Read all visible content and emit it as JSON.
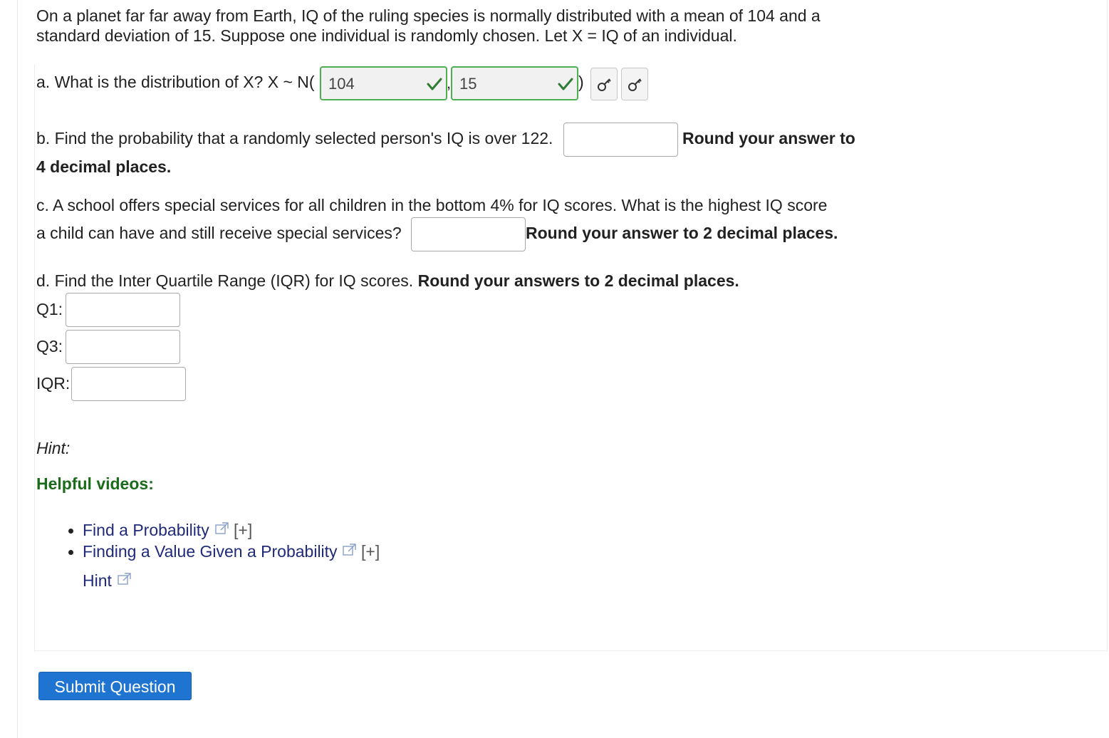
{
  "intro": {
    "line1": "On a planet far far away from Earth, IQ of the ruling species is normally distributed with a mean of 104 and a",
    "line2": "standard deviation of 15. Suppose one individual is randomly chosen. Let X = IQ of an individual."
  },
  "part_a": {
    "prompt": "a. What is the distribution of X? X ~ N(",
    "mean_value": "104",
    "comma": ",",
    "sd_value": "15",
    "close_paren": ")",
    "mean_status": "correct",
    "sd_status": "correct",
    "key_icon_1": "key-icon",
    "key_icon_2": "key-icon"
  },
  "part_b": {
    "prompt": "b. Find the probability that a randomly selected person's IQ is over 122.",
    "instruction_1": "Round your answer to",
    "instruction_2": "4 decimal places.",
    "answer_value": ""
  },
  "part_c": {
    "prompt_1": "c. A school offers special services for all children in the bottom 4% for IQ scores. What is the highest IQ score",
    "prompt_2": "a child can have and still receive special services?",
    "instruction": "Round your answer to 2 decimal places.",
    "answer_value": ""
  },
  "part_d": {
    "prompt": "d. Find the Inter Quartile Range (IQR) for IQ scores. ",
    "instruction": "Round your answers to 2 decimal places.",
    "q1_label": "Q1:",
    "q3_label": "Q3:",
    "iqr_label": "IQR:",
    "q1_value": "",
    "q3_value": "",
    "iqr_value": ""
  },
  "hint_label": "Hint:",
  "helpful_videos": {
    "title": "Helpful videos:",
    "items": [
      {
        "label": "Find a Probability",
        "expand": "[+]"
      },
      {
        "label": "Finding a Value Given a Probability",
        "expand": "[+]"
      }
    ],
    "hint_link": "Hint"
  },
  "submit_label": "Submit Question",
  "colors": {
    "correct_border": "#4caf50",
    "check": "#2e7d32",
    "link": "#1f2a7a",
    "videos_title": "#1b6b1b",
    "submit_bg": "#1e74d0"
  }
}
